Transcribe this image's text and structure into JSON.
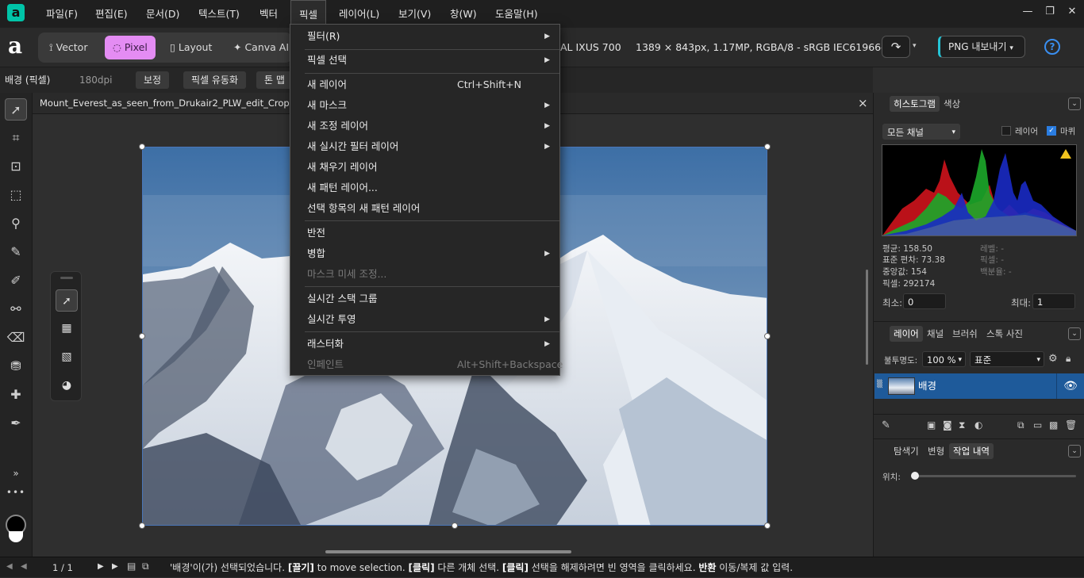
{
  "menubar": {
    "logo": "a",
    "items": [
      "파일(F)",
      "편집(E)",
      "문서(D)",
      "텍스트(T)",
      "벡터",
      "픽셀",
      "레이어(L)",
      "보기(V)",
      "창(W)",
      "도움말(H)"
    ],
    "window_controls": [
      "—",
      "❐",
      "✕"
    ]
  },
  "toolbar": {
    "brand": "a",
    "personas": [
      "Vector",
      "Pixel",
      "Layout",
      "Canva AI"
    ],
    "camera_info": "AL IXUS 700",
    "doc_info": "1389 × 843px, 1.17MP, RGBA/8 - sRGB IEC61966-2.1",
    "export_label": "PNG 내보내기",
    "help": "?"
  },
  "contextbar": {
    "layer_name": "배경 (픽셀)",
    "dpi": "180dpi",
    "buttons": [
      "보정",
      "픽셀 유동화",
      "톤 맵"
    ]
  },
  "document": {
    "tab_title": "Mount_Everest_as_seen_from_Drukair2_PLW_edit_Cropped.jpg (",
    "close": "×"
  },
  "pixel_menu": {
    "items": [
      {
        "label": "필터(R)",
        "shortcut": "",
        "submenu": true,
        "disabled": false
      },
      {
        "label": "픽셀 선택",
        "shortcut": "",
        "submenu": true,
        "disabled": false
      },
      {
        "label": "새 레이어",
        "shortcut": "Ctrl+Shift+N",
        "submenu": false,
        "disabled": false
      },
      {
        "label": "새 마스크",
        "shortcut": "",
        "submenu": true,
        "disabled": false
      },
      {
        "label": "새 조정 레이어",
        "shortcut": "",
        "submenu": true,
        "disabled": false
      },
      {
        "label": "새 실시간 필터 레이어",
        "shortcut": "",
        "submenu": true,
        "disabled": false
      },
      {
        "label": "새 채우기 레이어",
        "shortcut": "",
        "submenu": false,
        "disabled": false
      },
      {
        "label": "새 패턴 레이어...",
        "shortcut": "",
        "submenu": false,
        "disabled": false
      },
      {
        "label": "선택 항목의 새 패턴 레이어",
        "shortcut": "",
        "submenu": false,
        "disabled": false
      },
      {
        "label": "반전",
        "shortcut": "",
        "submenu": false,
        "disabled": false
      },
      {
        "label": "병합",
        "shortcut": "",
        "submenu": true,
        "disabled": false
      },
      {
        "label": "마스크 미세 조정...",
        "shortcut": "",
        "submenu": false,
        "disabled": true
      },
      {
        "label": "실시간 스택 그룹",
        "shortcut": "",
        "submenu": false,
        "disabled": false
      },
      {
        "label": "실시간 투영",
        "shortcut": "",
        "submenu": true,
        "disabled": false
      },
      {
        "label": "래스터화",
        "shortcut": "",
        "submenu": true,
        "disabled": false
      },
      {
        "label": "인페인트",
        "shortcut": "Alt+Shift+Backspace",
        "submenu": false,
        "disabled": true
      }
    ]
  },
  "histogram_panel": {
    "tabs": [
      "히스토그램",
      "색상"
    ],
    "channel": "모든 채널",
    "layer_label": "레이어",
    "marquee_label": "마퀴",
    "stats_left": [
      "평균: 158.50",
      "표준 편차: 73.38",
      "중앙값: 154",
      "픽셀: 292174"
    ],
    "stats_right": [
      "레벨: -",
      "픽셀: -",
      "백분율: -"
    ],
    "min_label": "최소:",
    "min_value": "0",
    "max_label": "최대:",
    "max_value": "1"
  },
  "layers_panel": {
    "tabs": [
      "레이어",
      "채널",
      "브러쉬",
      "스톡 사진"
    ],
    "opacity_label": "불투명도:",
    "opacity_value": "100 %",
    "blend_mode": "표준",
    "layer_name": "배경"
  },
  "history_panel": {
    "tabs": [
      "탐색기",
      "변형",
      "작업 내역"
    ],
    "position_label": "위치:"
  },
  "statusbar": {
    "page": "1 / 1",
    "message_parts": [
      {
        "t": "'배경'이(가) 선택되었습니다. ",
        "b": false
      },
      {
        "t": "[끌기]",
        "b": true
      },
      {
        "t": " to move selection. ",
        "b": false
      },
      {
        "t": "[클릭]",
        "b": true
      },
      {
        "t": " 다른 개체 선택. ",
        "b": false
      },
      {
        "t": "[클릭]",
        "b": true
      },
      {
        "t": " 선택을 해제하려면 빈 영역을 클릭하세요. ",
        "b": false
      },
      {
        "t": "반환",
        "b": true
      },
      {
        "t": " 이동/복제 값 입력.",
        "b": false
      }
    ]
  },
  "colors": {
    "accent_pixel": "#e48cf3",
    "layer_selected": "#1e5a9a",
    "selection_border": "#4a76b8"
  }
}
